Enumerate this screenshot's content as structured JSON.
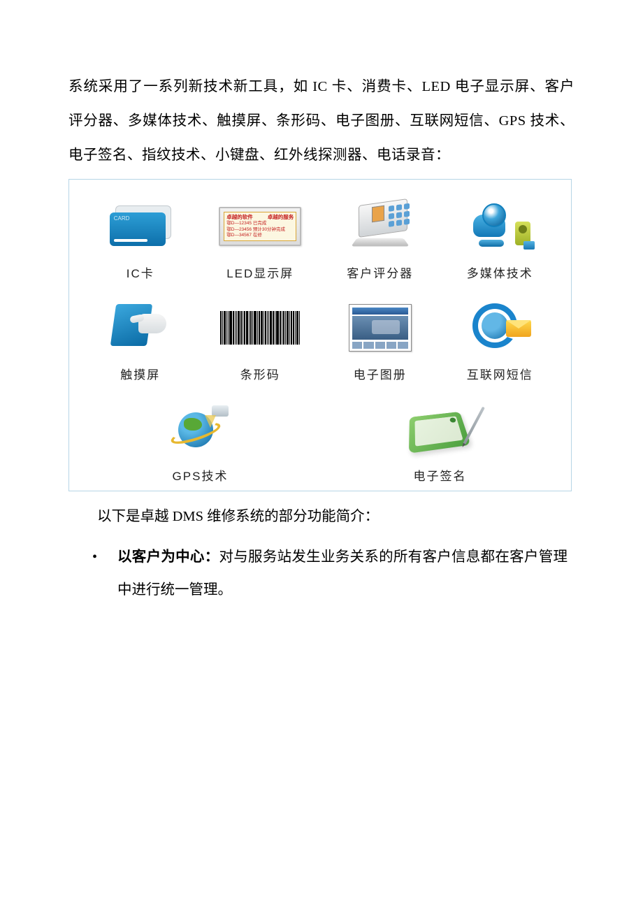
{
  "paragraph": "系统采用了一系列新技术新工具，如 IC 卡、消费卡、LED 电子显示屏、客户评分器、多媒体技术、触摸屏、条形码、电子图册、互联网短信、GPS 技术、电子签名、指纹技术、小键盘、红外线探测器、电话录音：",
  "tech": {
    "items": [
      {
        "label": "IC卡",
        "icon": "ic-card"
      },
      {
        "label": "LED显示屏",
        "icon": "led-sign"
      },
      {
        "label": "客户评分器",
        "icon": "rater"
      },
      {
        "label": "多媒体技术",
        "icon": "multimedia"
      },
      {
        "label": "触摸屏",
        "icon": "touch"
      },
      {
        "label": "条形码",
        "icon": "barcode"
      },
      {
        "label": "电子图册",
        "icon": "album"
      },
      {
        "label": "互联网短信",
        "icon": "net-mail"
      },
      {
        "label": "GPS技术",
        "icon": "gps"
      },
      {
        "label": "电子签名",
        "icon": "esign"
      }
    ]
  },
  "led": {
    "hd_left": "卓越的软件",
    "hd_right": "卓越的服务",
    "line1": "鄂D—12345   已完成",
    "line2": "鄂D—23456   预计30分钟完成",
    "line3": "鄂D—34567   在修"
  },
  "card_tag": "CARD",
  "intro": "以下是卓越 DMS 维修系统的部分功能简介：",
  "bullet": {
    "mark": "•",
    "bold": "以客户为中心：",
    "rest": "对与服务站发生业务关系的所有客户信息都在客户管理中进行统一管理。"
  }
}
